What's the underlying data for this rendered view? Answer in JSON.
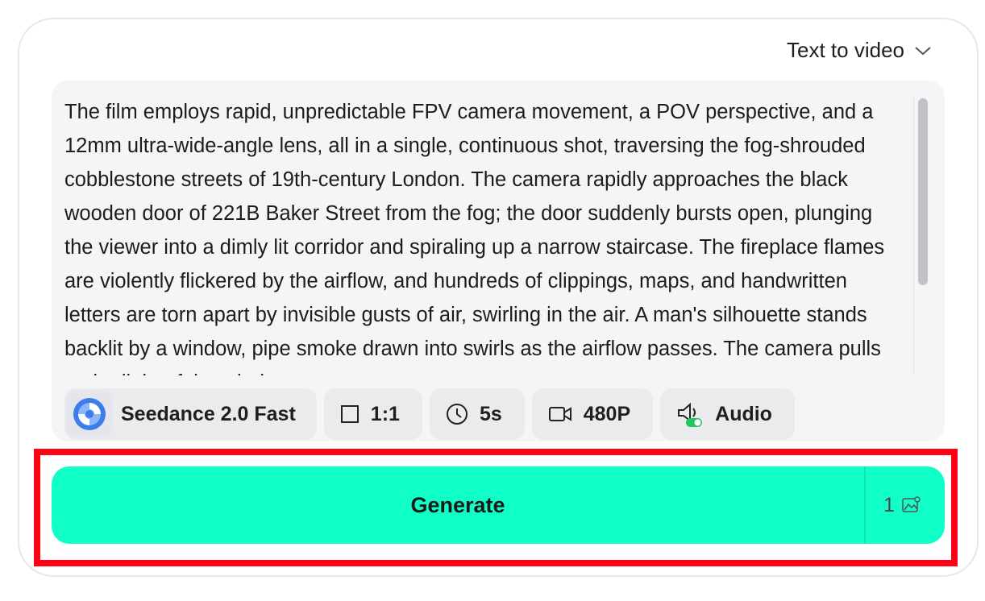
{
  "mode_selector": {
    "label": "Text to video",
    "icon": "chevron-down-icon"
  },
  "prompt": {
    "text": "The film employs rapid, unpredictable FPV camera movement, a POV perspective, and a 12mm ultra-wide-angle lens, all in a single, continuous shot, traversing the fog-shrouded cobblestone streets of 19th-century London. The camera rapidly approaches the black wooden door of 221B Baker Street from the fog; the door suddenly bursts open, plunging the viewer into a dimly lit corridor and spiraling up a narrow staircase. The fireplace flames are violently flickered by the airflow, and hundreds of clippings, maps, and handwritten letters are torn apart by invisible gusts of air, swirling in the air. A man's silhouette stands backlit by a window, pipe smoke drawn into swirls as the airflow passes. The camera pulls to the light of the window."
  },
  "options": {
    "model": {
      "label": "Seedance 2.0 Fast",
      "icon": "seedance-logo-icon"
    },
    "aspect_ratio": {
      "label": "1:1",
      "icon": "square-icon"
    },
    "duration": {
      "label": "5s",
      "icon": "clock-icon"
    },
    "resolution": {
      "label": "480P",
      "icon": "video-camera-icon"
    },
    "audio": {
      "label": "Audio",
      "icon": "audio-icon",
      "enabled": true
    }
  },
  "generate": {
    "label": "Generate",
    "cost": "1",
    "cost_icon": "image-credit-icon"
  },
  "colors": {
    "accent": "#10ffc8",
    "highlight": "#ff0014",
    "toggle_on": "#22c55e"
  }
}
